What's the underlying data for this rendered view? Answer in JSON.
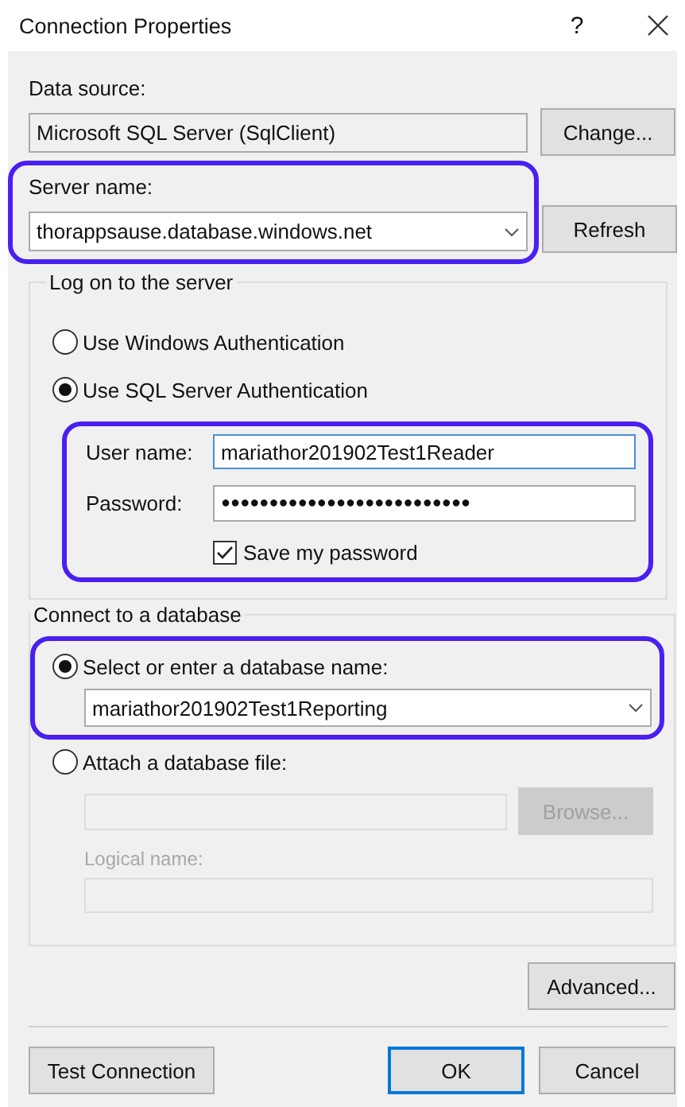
{
  "window": {
    "title": "Connection Properties",
    "help": "?"
  },
  "data_source": {
    "label": "Data source:",
    "value": "Microsoft SQL Server (SqlClient)",
    "button": "Change..."
  },
  "server_name": {
    "label": "Server name:",
    "value": "thorappsause.database.windows.net",
    "button": "Refresh",
    "highlighted": true
  },
  "log_on": {
    "title": "Log on to the server",
    "options": [
      {
        "label": "Use Windows Authentication",
        "selected": false
      },
      {
        "label": "Use SQL Server Authentication",
        "selected": true
      }
    ],
    "credentials": {
      "highlighted": true,
      "user_label": "User name:",
      "user_value": "mariathor201902Test1Reader",
      "focused": true,
      "password_label": "Password:",
      "password_value": "●●●●●●●●●●●●●●●●●●●●●●●●●●",
      "save_label": "Save my password",
      "save_checked": true
    }
  },
  "database": {
    "title": "Connect to a database",
    "select": {
      "label": "Select or enter a database name:",
      "selected": true,
      "value": "mariathor201902Test1Reporting",
      "highlighted": true
    },
    "attach": {
      "label": "Attach a database file:",
      "selected": false,
      "disabled": true,
      "browse": "Browse...",
      "logical_label": "Logical name:"
    }
  },
  "advanced_button": "Advanced...",
  "footer": [
    {
      "label": "Test Connection",
      "default": false
    },
    {
      "label": "OK",
      "default": true
    },
    {
      "label": "Cancel",
      "default": false
    }
  ]
}
